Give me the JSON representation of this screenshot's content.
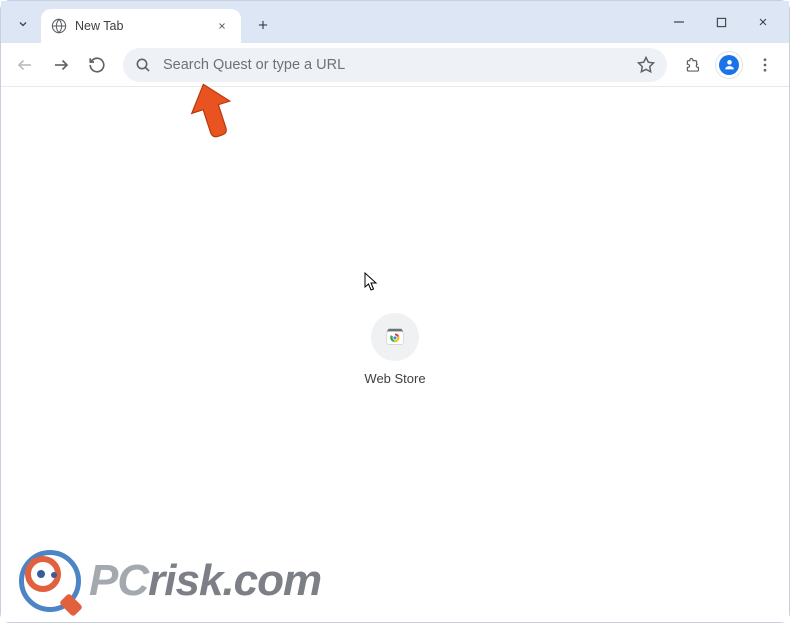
{
  "tab": {
    "title": "New Tab"
  },
  "omnibox": {
    "placeholder": "Search Quest or type a URL",
    "value": ""
  },
  "shortcuts": [
    {
      "label": "Web Store"
    }
  ],
  "watermark": {
    "text_pc": "PC",
    "text_risk": "risk.com"
  }
}
